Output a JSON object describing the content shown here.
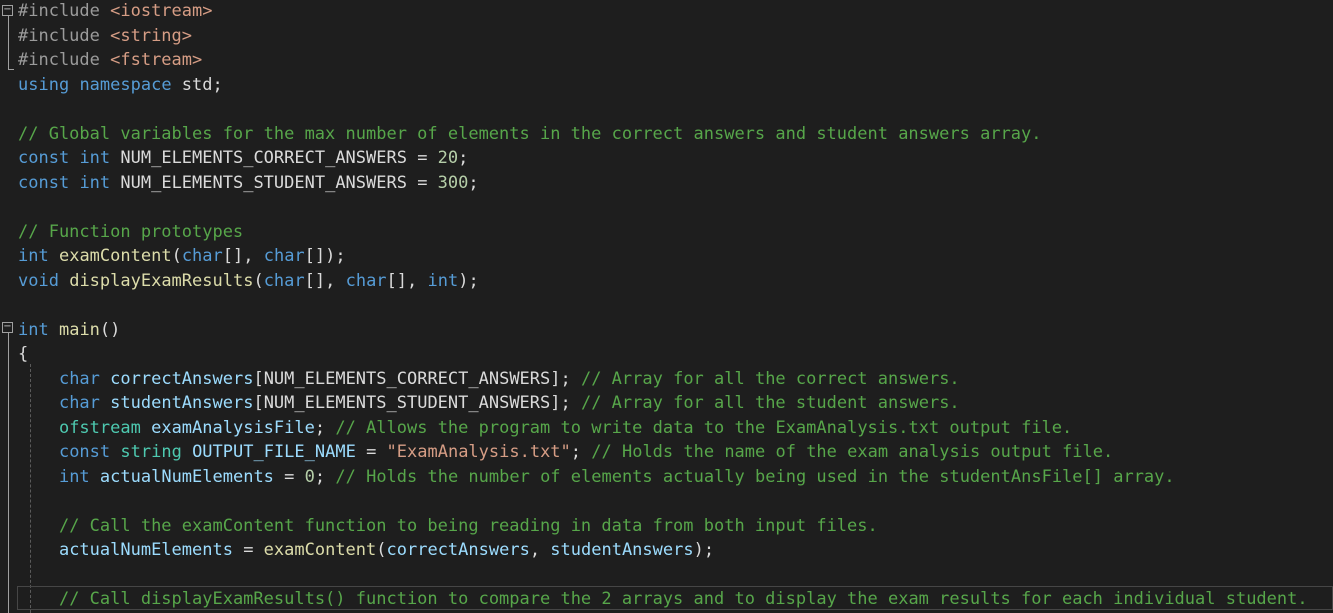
{
  "editor": {
    "lines": [
      {
        "segs": [
          {
            "t": "#include ",
            "c": "pp"
          },
          {
            "t": "<iostream>",
            "c": "inc"
          }
        ]
      },
      {
        "segs": [
          {
            "t": "#include ",
            "c": "pp"
          },
          {
            "t": "<string>",
            "c": "inc"
          }
        ]
      },
      {
        "segs": [
          {
            "t": "#include ",
            "c": "pp"
          },
          {
            "t": "<fstream>",
            "c": "inc"
          }
        ]
      },
      {
        "segs": [
          {
            "t": "using",
            "c": "kw"
          },
          {
            "t": " ",
            "c": "id"
          },
          {
            "t": "namespace",
            "c": "kw"
          },
          {
            "t": " std;",
            "c": "id"
          }
        ]
      },
      {
        "segs": []
      },
      {
        "segs": [
          {
            "t": "// Global variables for the max number of elements in the correct answers and student answers array.",
            "c": "cm"
          }
        ]
      },
      {
        "segs": [
          {
            "t": "const",
            "c": "kw"
          },
          {
            "t": " ",
            "c": "id"
          },
          {
            "t": "int",
            "c": "kw"
          },
          {
            "t": " NUM_ELEMENTS_CORRECT_ANSWERS = ",
            "c": "id"
          },
          {
            "t": "20",
            "c": "num"
          },
          {
            "t": ";",
            "c": "id"
          }
        ]
      },
      {
        "segs": [
          {
            "t": "const",
            "c": "kw"
          },
          {
            "t": " ",
            "c": "id"
          },
          {
            "t": "int",
            "c": "kw"
          },
          {
            "t": " NUM_ELEMENTS_STUDENT_ANSWERS = ",
            "c": "id"
          },
          {
            "t": "300",
            "c": "num"
          },
          {
            "t": ";",
            "c": "id"
          }
        ]
      },
      {
        "segs": []
      },
      {
        "segs": [
          {
            "t": "// Function prototypes",
            "c": "cm"
          }
        ]
      },
      {
        "segs": [
          {
            "t": "int",
            "c": "kw"
          },
          {
            "t": " ",
            "c": "id"
          },
          {
            "t": "examContent",
            "c": "fn"
          },
          {
            "t": "(",
            "c": "id"
          },
          {
            "t": "char",
            "c": "kw"
          },
          {
            "t": "[], ",
            "c": "id"
          },
          {
            "t": "char",
            "c": "kw"
          },
          {
            "t": "[]);",
            "c": "id"
          }
        ]
      },
      {
        "segs": [
          {
            "t": "void",
            "c": "kw"
          },
          {
            "t": " ",
            "c": "id"
          },
          {
            "t": "displayExamResults",
            "c": "fn"
          },
          {
            "t": "(",
            "c": "id"
          },
          {
            "t": "char",
            "c": "kw"
          },
          {
            "t": "[], ",
            "c": "id"
          },
          {
            "t": "char",
            "c": "kw"
          },
          {
            "t": "[], ",
            "c": "id"
          },
          {
            "t": "int",
            "c": "kw"
          },
          {
            "t": ");",
            "c": "id"
          }
        ]
      },
      {
        "segs": []
      },
      {
        "segs": [
          {
            "t": "int",
            "c": "kw"
          },
          {
            "t": " ",
            "c": "id"
          },
          {
            "t": "main",
            "c": "fn"
          },
          {
            "t": "()",
            "c": "id"
          }
        ]
      },
      {
        "segs": [
          {
            "t": "{",
            "c": "id"
          }
        ]
      },
      {
        "segs": [
          {
            "t": "    ",
            "c": "id"
          },
          {
            "t": "char",
            "c": "kw"
          },
          {
            "t": " ",
            "c": "id"
          },
          {
            "t": "correctAnswers",
            "c": "var"
          },
          {
            "t": "[NUM_ELEMENTS_CORRECT_ANSWERS]; ",
            "c": "id"
          },
          {
            "t": "// Array for all the correct answers.",
            "c": "cm"
          }
        ]
      },
      {
        "segs": [
          {
            "t": "    ",
            "c": "id"
          },
          {
            "t": "char",
            "c": "kw"
          },
          {
            "t": " ",
            "c": "id"
          },
          {
            "t": "studentAnswers",
            "c": "var"
          },
          {
            "t": "[NUM_ELEMENTS_STUDENT_ANSWERS]; ",
            "c": "id"
          },
          {
            "t": "// Array for all the student answers.",
            "c": "cm"
          }
        ]
      },
      {
        "segs": [
          {
            "t": "    ",
            "c": "id"
          },
          {
            "t": "ofstream",
            "c": "typ"
          },
          {
            "t": " ",
            "c": "id"
          },
          {
            "t": "examAnalysisFile",
            "c": "var"
          },
          {
            "t": "; ",
            "c": "id"
          },
          {
            "t": "// Allows the program to write data to the ExamAnalysis.txt output file.",
            "c": "cm"
          }
        ]
      },
      {
        "segs": [
          {
            "t": "    ",
            "c": "id"
          },
          {
            "t": "const",
            "c": "kw"
          },
          {
            "t": " ",
            "c": "id"
          },
          {
            "t": "string",
            "c": "typ"
          },
          {
            "t": " ",
            "c": "id"
          },
          {
            "t": "OUTPUT_FILE_NAME",
            "c": "var"
          },
          {
            "t": " = ",
            "c": "id"
          },
          {
            "t": "\"ExamAnalysis.txt\"",
            "c": "str"
          },
          {
            "t": "; ",
            "c": "id"
          },
          {
            "t": "// Holds the name of the exam analysis output file.",
            "c": "cm"
          }
        ]
      },
      {
        "segs": [
          {
            "t": "    ",
            "c": "id"
          },
          {
            "t": "int",
            "c": "kw"
          },
          {
            "t": " ",
            "c": "id"
          },
          {
            "t": "actualNumElements",
            "c": "var"
          },
          {
            "t": " = ",
            "c": "id"
          },
          {
            "t": "0",
            "c": "num"
          },
          {
            "t": "; ",
            "c": "id"
          },
          {
            "t": "// Holds the number of elements actually being used in the studentAnsFile[] array.",
            "c": "cm"
          }
        ]
      },
      {
        "segs": []
      },
      {
        "segs": [
          {
            "t": "    ",
            "c": "id"
          },
          {
            "t": "// Call the examContent function to being reading in data from both input files.",
            "c": "cm"
          }
        ]
      },
      {
        "segs": [
          {
            "t": "    ",
            "c": "id"
          },
          {
            "t": "actualNumElements",
            "c": "var"
          },
          {
            "t": " = ",
            "c": "id"
          },
          {
            "t": "examContent",
            "c": "fn"
          },
          {
            "t": "(",
            "c": "id"
          },
          {
            "t": "correctAnswers",
            "c": "var"
          },
          {
            "t": ", ",
            "c": "id"
          },
          {
            "t": "studentAnswers",
            "c": "var"
          },
          {
            "t": ");",
            "c": "id"
          }
        ]
      },
      {
        "segs": []
      },
      {
        "segs": [
          {
            "t": "    ",
            "c": "id"
          },
          {
            "t": "// Call displayExamResults() function to compare the 2 arrays and to display the exam results for each individual student.",
            "c": "cm"
          }
        ]
      }
    ]
  }
}
